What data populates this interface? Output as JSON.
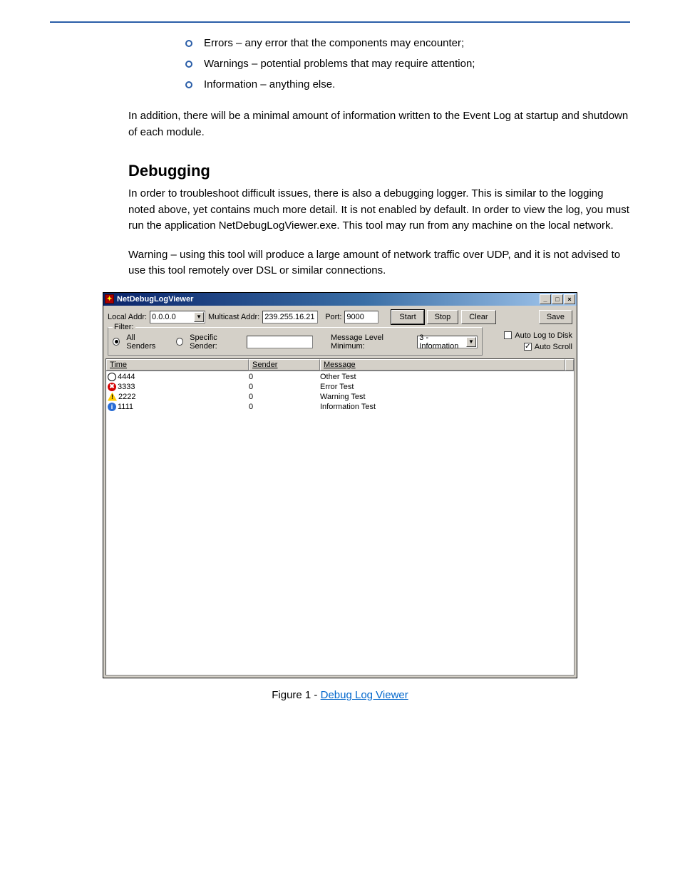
{
  "bullets": [
    "Errors – any error that the components may encounter;",
    "Warnings – potential problems that may require attention;",
    "Information – anything else."
  ],
  "paragraphs": {
    "p1": "In addition, there will be a minimal amount of information written to the Event Log at startup and shutdown of each module.",
    "p2": "In order to troubleshoot difficult issues, there is also a debugging logger. This is similar to the logging noted above, yet contains much more detail. It is not enabled by default. In order to view the log, you must run the application NetDebugLogViewer.exe. This tool may run from any machine on the local network.",
    "p3": "Warning – using this tool will produce a large amount of network traffic over UDP, and it is not advised to use this tool remotely over DSL or similar connections."
  },
  "heading": "Debugging",
  "figure": {
    "label": "Figure 1 -",
    "link": "Debug Log Viewer"
  },
  "app": {
    "title": "NetDebugLogViewer",
    "toolbar": {
      "localaddr_label": "Local Addr:",
      "localaddr_value": "0.0.0.0",
      "multicast_label": "Multicast Addr:",
      "multicast_value": "239.255.16.21",
      "port_label": "Port:",
      "port_value": "9000",
      "start": "Start",
      "stop": "Stop",
      "clear": "Clear",
      "save": "Save"
    },
    "filter": {
      "legend": "Filter:",
      "all_senders": "All Senders",
      "specific_sender": "Specific Sender:",
      "specific_value": "",
      "level_label": "Message Level Minimum:",
      "level_value": "3 - Information"
    },
    "right": {
      "autolog": "Auto Log to Disk",
      "autoscroll": "Auto Scroll"
    },
    "columns": {
      "time": "Time",
      "sender": "Sender",
      "message": "Message"
    },
    "rows": [
      {
        "icon": "other",
        "time": "4444",
        "sender": "0",
        "message": "Other Test"
      },
      {
        "icon": "error",
        "time": "3333",
        "sender": "0",
        "message": "Error Test"
      },
      {
        "icon": "warn",
        "time": "2222",
        "sender": "0",
        "message": "Warning Test"
      },
      {
        "icon": "info",
        "time": "1111",
        "sender": "0",
        "message": "Information Test"
      }
    ]
  }
}
